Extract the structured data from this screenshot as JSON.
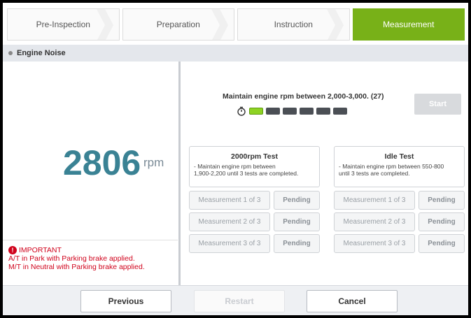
{
  "steps": [
    {
      "label": "Pre-Inspection",
      "active": false
    },
    {
      "label": "Preparation",
      "active": false
    },
    {
      "label": "Instruction",
      "active": false
    },
    {
      "label": "Measurement",
      "active": true
    }
  ],
  "section": {
    "title": "Engine Noise"
  },
  "rpm": {
    "value": "2806",
    "unit": "rpm"
  },
  "important": {
    "title": "IMPORTANT",
    "lines": [
      "A/T in Park with Parking brake applied.",
      "M/T in Neutral with Parking brake applied."
    ]
  },
  "instruction": "Maintain engine rpm between 2,000-3,000. (27)",
  "progress": {
    "total_segments": 6,
    "active_segments": 1
  },
  "start_label": "Start",
  "tests": [
    {
      "title": "2000rpm Test",
      "desc_1": " - Maintain engine rpm between",
      "desc_2": "1,900-2,200 until 3 tests are completed.",
      "measurements": [
        {
          "label": "Measurement 1 of 3",
          "status": "Pending"
        },
        {
          "label": "Measurement 2 of 3",
          "status": "Pending"
        },
        {
          "label": "Measurement 3 of 3",
          "status": "Pending"
        }
      ]
    },
    {
      "title": "Idle Test",
      "desc_1": " - Maintain engine rpm between 550-800",
      "desc_2": "until 3 tests are completed.",
      "measurements": [
        {
          "label": "Measurement 1 of 3",
          "status": "Pending"
        },
        {
          "label": "Measurement 2 of 3",
          "status": "Pending"
        },
        {
          "label": "Measurement 3 of 3",
          "status": "Pending"
        }
      ]
    }
  ],
  "footer": {
    "previous": "Previous",
    "restart": "Restart",
    "cancel": "Cancel"
  },
  "colors": {
    "accent": "#78b118",
    "rpm": "#3a8294",
    "warning": "#d0021b"
  }
}
